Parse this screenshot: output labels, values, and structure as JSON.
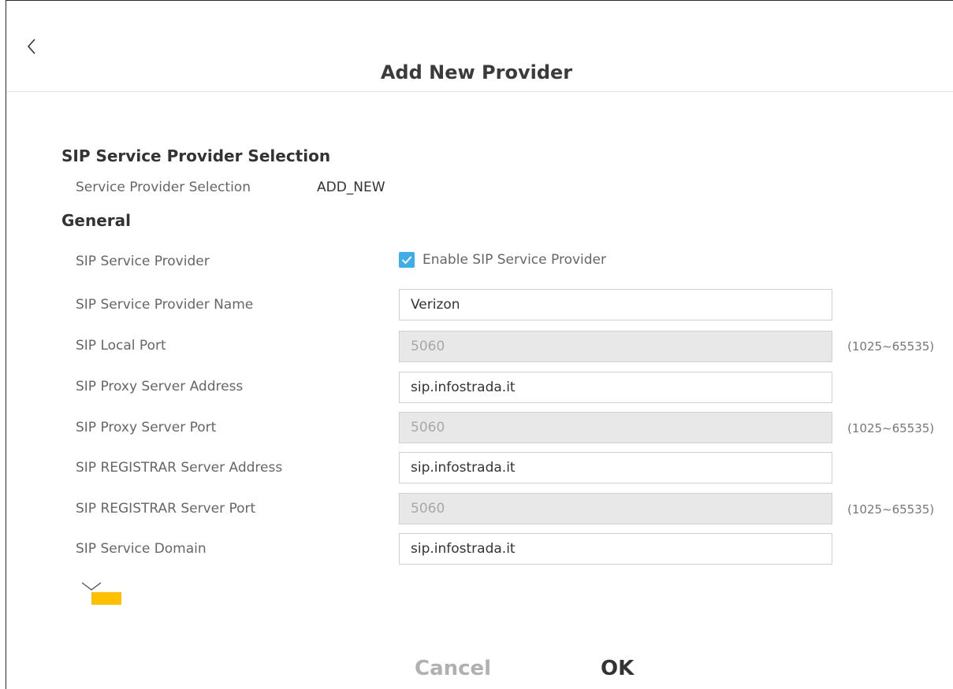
{
  "header": {
    "title": "Add New Provider",
    "back_icon": "chevron-left-icon"
  },
  "section1": {
    "title": "SIP Service Provider Selection",
    "label": "Service Provider Selection",
    "value": "ADD_NEW"
  },
  "section2": {
    "title": "General",
    "enable": {
      "label": "SIP Service Provider",
      "checkbox_label": "Enable SIP Service Provider",
      "checked": true
    },
    "rows": [
      {
        "label": "SIP Service Provider Name",
        "value": "Verizon",
        "hint": ""
      },
      {
        "label": "SIP Local Port",
        "value": "5060",
        "hint": "(1025~65535)"
      },
      {
        "label": "SIP Proxy Server Address",
        "value": "sip.infostrada.it",
        "hint": ""
      },
      {
        "label": "SIP Proxy Server Port",
        "value": "5060",
        "hint": "(1025~65535)"
      },
      {
        "label": "SIP REGISTRAR Server Address",
        "value": "sip.infostrada.it",
        "hint": ""
      },
      {
        "label": "SIP REGISTRAR Server Port",
        "value": "5060",
        "hint": "(1025~65535)"
      },
      {
        "label": "SIP Service Domain",
        "value": "sip.infostrada.it",
        "hint": ""
      }
    ]
  },
  "more_icon": "chevron-down-icon",
  "footer": {
    "cancel_label": "Cancel",
    "ok_label": "OK"
  },
  "colors": {
    "accent": "#3daee9",
    "highlight": "#ffc000"
  }
}
